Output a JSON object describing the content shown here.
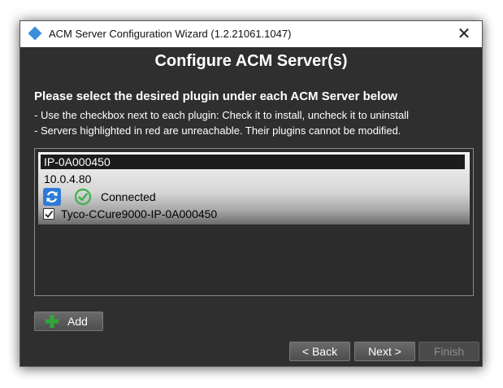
{
  "window": {
    "title": "ACM Server Configuration Wizard (1.2.21061.1047)",
    "close_glyph": "✕"
  },
  "main": {
    "heading": "Configure ACM Server(s)",
    "subheading": "Please select the desired plugin under each ACM Server below",
    "instructions": [
      "- Use the checkbox next to each plugin: Check it to install, uncheck it to uninstall",
      "- Servers highlighted in red are unreachable. Their plugins cannot be modified."
    ]
  },
  "servers": [
    {
      "name": "IP-0A000450",
      "ip": "10.0.4.80",
      "status": "Connected",
      "status_icon": "check-circle-icon",
      "refresh_icon": "refresh-icon",
      "plugins": [
        {
          "label": "Tyco-CCure9000-IP-0A000450",
          "checked": true
        }
      ]
    }
  ],
  "buttons": {
    "add": "Add",
    "back": "< Back",
    "next": "Next >",
    "finish": "Finish"
  },
  "colors": {
    "window_bg": "#2f2f2f",
    "selected_row_bg": "#1c1c1c",
    "accent_blue": "#2d7bd6",
    "success_green": "#3bb34a",
    "add_green": "#2fa83a"
  }
}
